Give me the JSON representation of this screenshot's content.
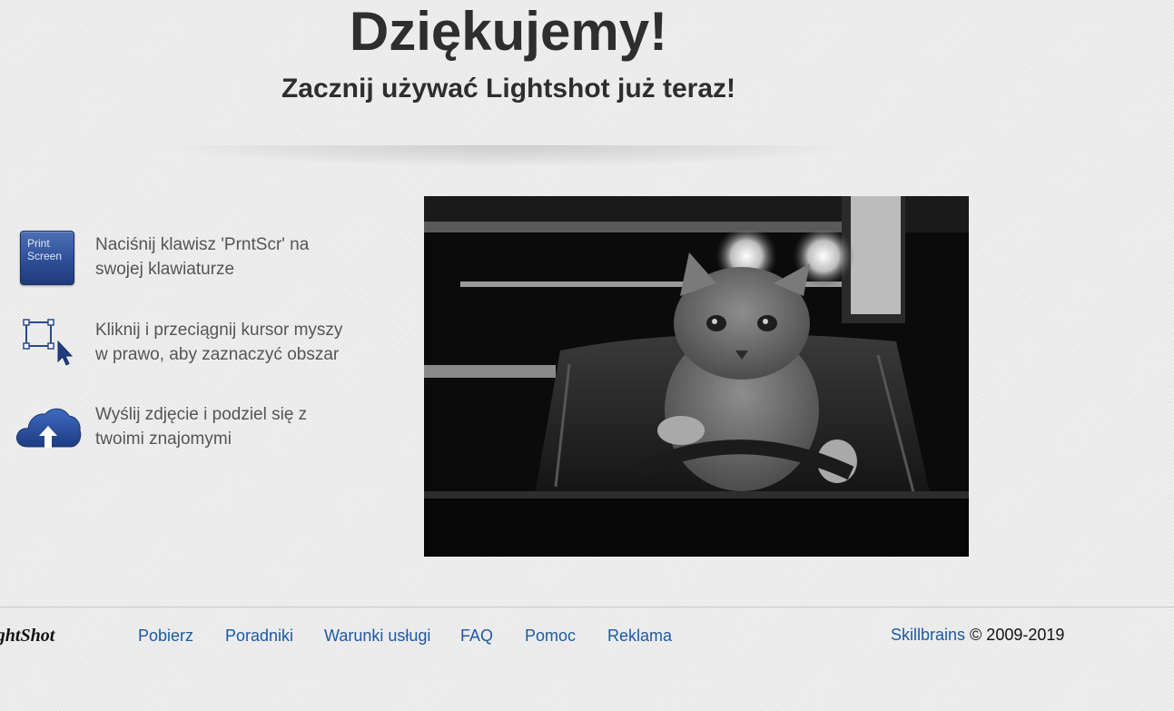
{
  "header": {
    "title": "Dziękujemy!",
    "subtitle": "Zacznij używać Lightshot już teraz!"
  },
  "steps": [
    {
      "icon": "print-screen-key-icon",
      "key_line1": "Print",
      "key_line2": "Screen",
      "line1": "Naciśnij klawisz 'PrntScr' na",
      "line2": "swojej klawiaturze"
    },
    {
      "icon": "selection-cursor-icon",
      "line1": "Kliknij i przeciągnij kursor myszy",
      "line2": "w prawo, aby zaznaczyć obszar"
    },
    {
      "icon": "cloud-upload-icon",
      "line1": "Wyślij zdjęcie i podziel się z",
      "line2": "twoimi znajomymi"
    }
  ],
  "media": {
    "description_icon": "cat-driving-animation"
  },
  "footer": {
    "logo": "LightShot",
    "links": [
      "Pobierz",
      "Poradniki",
      "Warunki usługi",
      "FAQ",
      "Pomoc",
      "Reklama"
    ],
    "company": "Skillbrains",
    "copyright": "© 2009-2019"
  },
  "colors": {
    "background": "#ebebeb",
    "heading": "#2e2e2e",
    "body_text": "#555555",
    "link": "#1c5aa3",
    "key_blue": "#2e4f97"
  }
}
